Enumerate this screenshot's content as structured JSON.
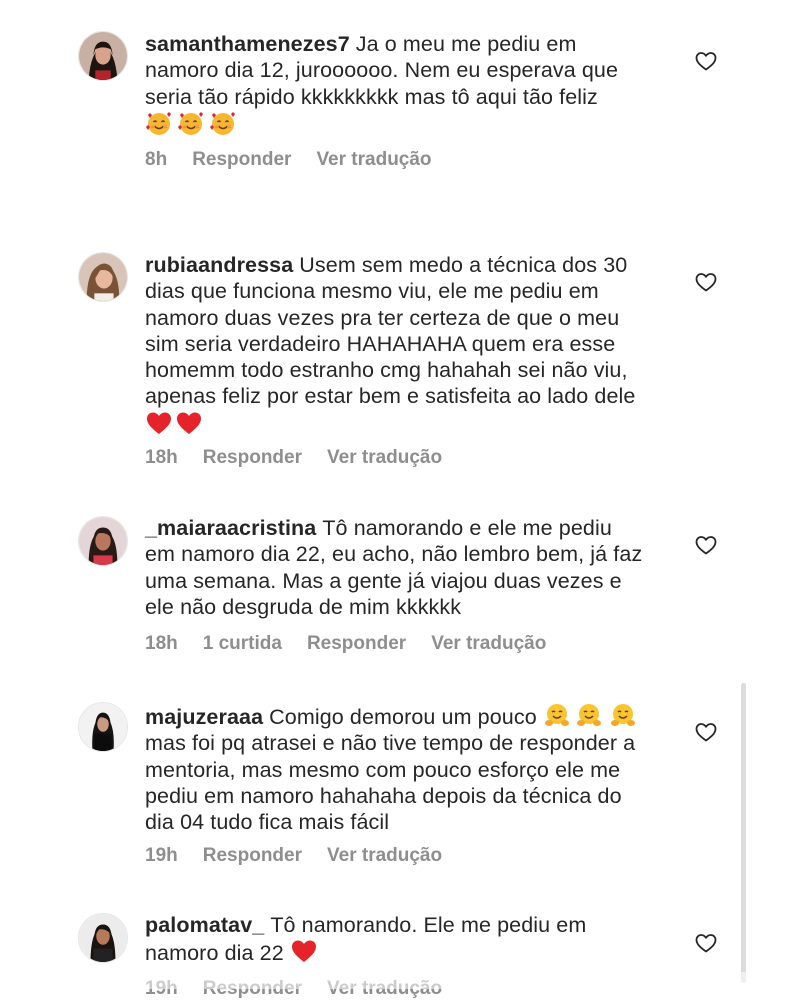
{
  "comments": [
    {
      "username": "samanthamenezes7",
      "text": "Ja o meu me pediu em namoro dia 12, juroooooo. Nem eu esperava que seria tão rápido kkkkkkkkk mas tô aqui tão feliz",
      "emojis": [
        "smiling-face-with-hearts",
        "smiling-face-with-hearts",
        "smiling-face-with-hearts"
      ],
      "time": "8h",
      "likes": "",
      "reply_label": "Responder",
      "translate_label": "Ver tradução"
    },
    {
      "username": "rubiaandressa",
      "text": "Usem sem medo a técnica dos 30 dias que funciona mesmo viu, ele me pediu em namoro duas vezes pra ter certeza de que o meu sim seria verdadeiro HAHAHAHA quem era esse homemm todo estranho cmg hahahah sei não viu, apenas feliz por estar bem e satisfeita ao lado dele",
      "emojis": [
        "red-heart",
        "red-heart"
      ],
      "time": "18h",
      "likes": "",
      "reply_label": "Responder",
      "translate_label": "Ver tradução"
    },
    {
      "username": "_maiaraacristina",
      "text": "Tô namorando e ele me pediu em namoro dia 22, eu acho, não lembro bem, já faz uma semana. Mas a gente já viajou duas vezes e ele não desgruda de mim kkkkkk",
      "emojis": [],
      "time": "18h",
      "likes": "1 curtida",
      "reply_label": "Responder",
      "translate_label": "Ver tradução"
    },
    {
      "username": "majuzeraaa",
      "text_before": "Comigo demorou um pouco",
      "emojis": [
        "hugging-face",
        "hugging-face",
        "hugging-face"
      ],
      "text": "mas foi pq atrasei e não tive tempo de responder a mentoria, mas mesmo com pouco esforço ele me pediu em namoro hahahaha depois da técnica do dia 04 tudo fica mais fácil",
      "time": "19h",
      "likes": "",
      "reply_label": "Responder",
      "translate_label": "Ver tradução"
    },
    {
      "username": "palomatav_",
      "text": "Tô namorando. Ele me pediu em namoro dia 22",
      "emojis": [
        "red-heart"
      ],
      "time": "19h",
      "likes": "",
      "reply_label": "Responder",
      "translate_label": "Ver tradução"
    }
  ],
  "icons": {
    "like": "heart-outline-icon"
  },
  "colors": {
    "text": "#262626",
    "meta": "#8e8e8e",
    "heart_emoji": "#e5232b",
    "background": "#ffffff"
  }
}
